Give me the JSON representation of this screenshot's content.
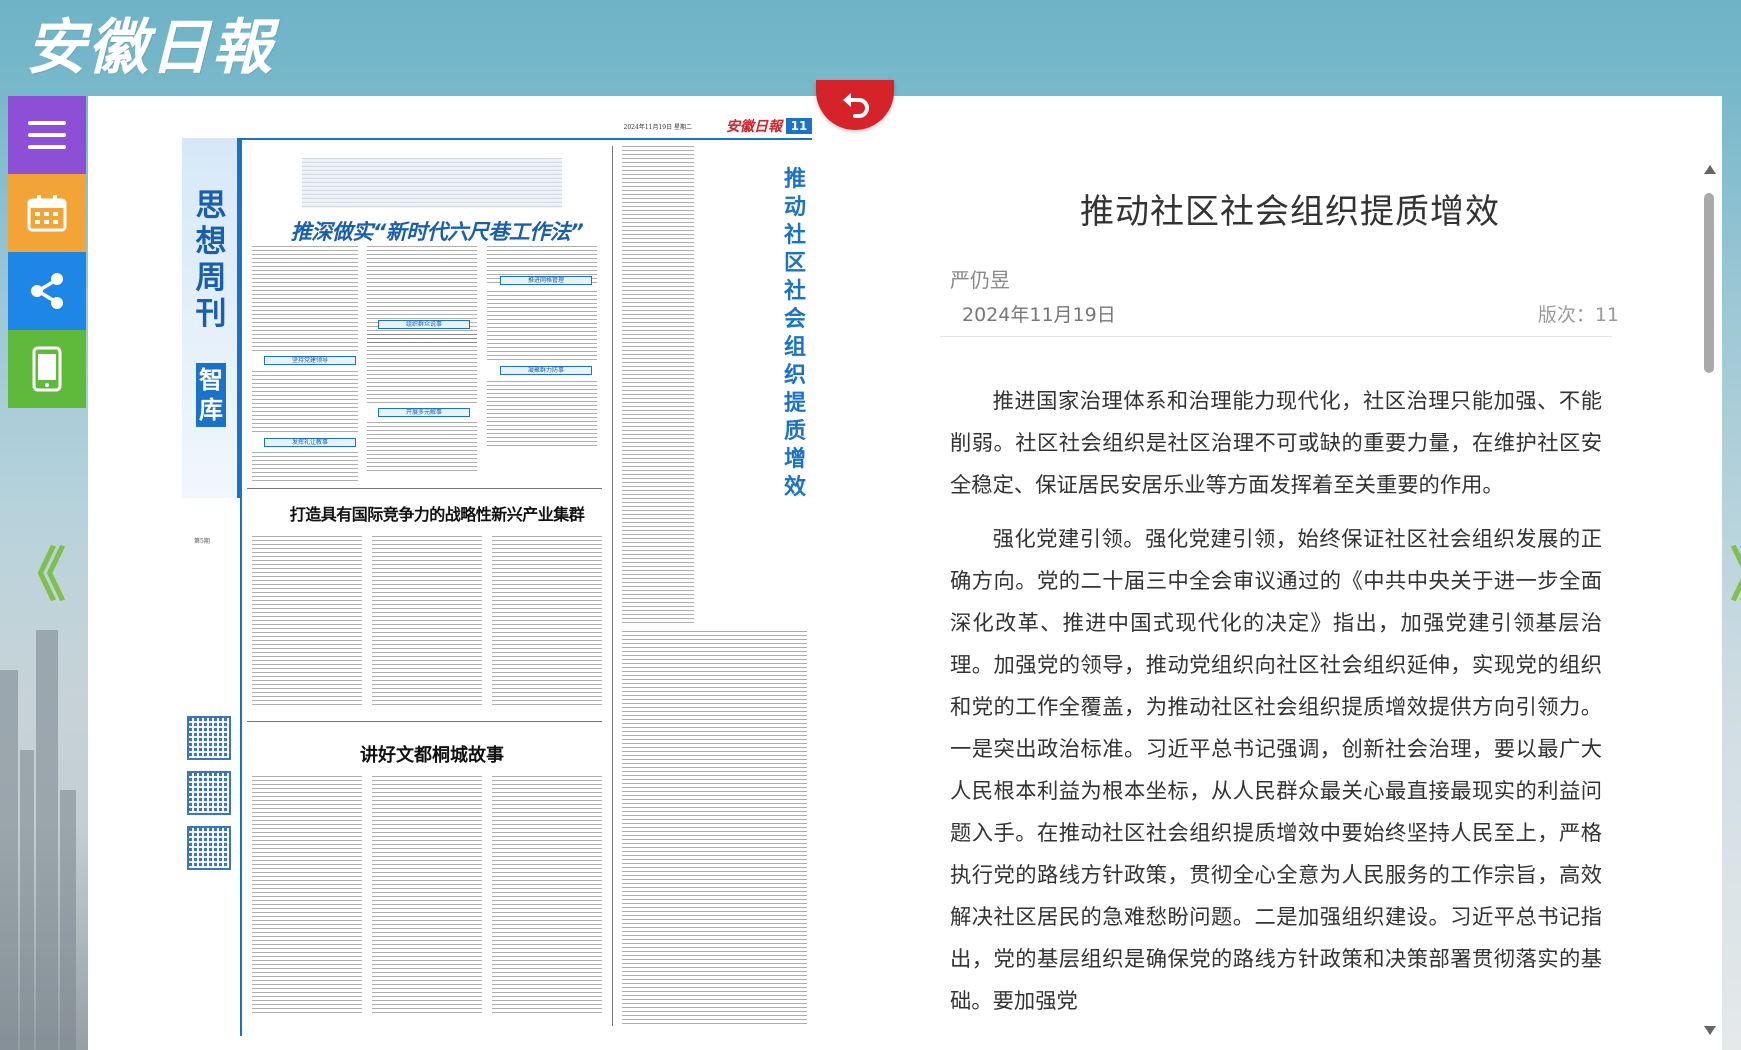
{
  "header": {
    "logo_text": "安徽日報"
  },
  "toolbar": {
    "menu_label": "menu",
    "calendar_label": "calendar",
    "share_label": "share",
    "mobile_label": "mobile"
  },
  "nav": {
    "prev_glyph": "《",
    "next_glyph": "》"
  },
  "newspaper": {
    "masthead": "安徽日報",
    "page_no": "11",
    "meta": "2024年11月19日  星期二",
    "column_title": "思想周刊",
    "column_sub": "智库",
    "edition_note": "第5期",
    "headline_1": "推深做实“新时代六尺巷工作法”",
    "headline_2": "打造具有国际竞争力的战略性新兴产业集群",
    "headline_3": "讲好文都桐城故事",
    "vertical_headline": "推动社区社会组织提质增效",
    "subheads": [
      "坚持党建领导",
      "组织群众说事",
      "推进网格管理",
      "凝聚群力防事",
      "开展多元解事",
      "发挥礼让教事"
    ]
  },
  "article": {
    "title": "推动社区社会组织提质增效",
    "author": "严仍昱",
    "date": "2024年11月19日",
    "page_label": "版次：11",
    "paragraphs": [
      "推进国家治理体系和治理能力现代化，社区治理只能加强、不能削弱。社区社会组织是社区治理不可或缺的重要力量，在维护社区安全稳定、保证居民安居乐业等方面发挥着至关重要的作用。",
      "强化党建引领。强化党建引领，始终保证社区社会组织发展的正确方向。党的二十届三中全会审议通过的《中共中央关于进一步全面深化改革、推进中国式现代化的决定》指出，加强党建引领基层治理。加强党的领导，推动党组织向社区社会组织延伸，实现党的组织和党的工作全覆盖，为推动社区社会组织提质增效提供方向引领力。一是突出政治标准。习近平总书记强调，创新社会治理，要以最广大人民根本利益为根本坐标，从人民群众最关心最直接最现实的利益问题入手。在推动社区社会组织提质增效中要始终坚持人民至上，严格执行党的路线方针政策，贯彻全心全意为人民服务的工作宗旨，高效解决社区居民的急难愁盼问题。二是加强组织建设。习近平总书记指出，党的基层组织是确保党的路线方针政策和决策部署贯彻落实的基础。要加强党"
    ]
  }
}
